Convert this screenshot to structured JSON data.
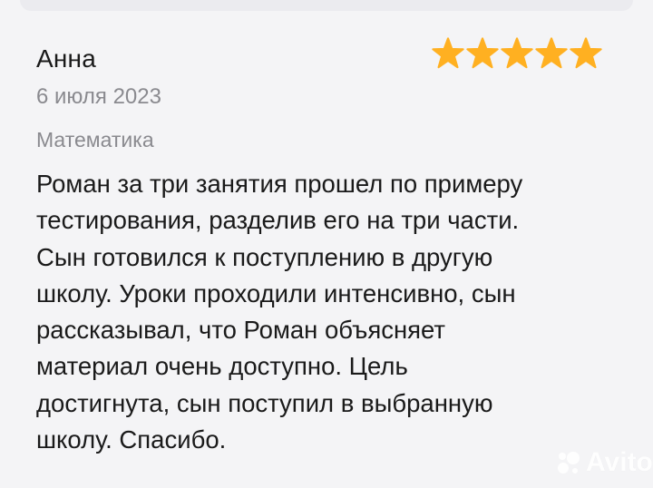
{
  "review": {
    "author": "Анна",
    "rating": 5,
    "rating_max": 5,
    "date": "6 июля 2023",
    "subject": "Математика",
    "text_lines": [
      "Роман за три занятия прошел по примеру",
      "тестирования, разделив его на три части.",
      "Сын готовился к поступлению в другую",
      "школу. Уроки проходили интенсивно, сын",
      "рассказывал, что Роман объясняет",
      "материал очень доступно. Цель",
      "достигнута, сын поступил в выбранную",
      "школу. Спасибо."
    ]
  },
  "watermark": {
    "text": "Avito"
  },
  "colors": {
    "background": "#f4f4f6",
    "text": "#1a1a1a",
    "muted": "#8a8a8f",
    "star": "#ffb021"
  },
  "icons": {
    "star": "star-icon",
    "watermark": "avito-logo-icon"
  }
}
